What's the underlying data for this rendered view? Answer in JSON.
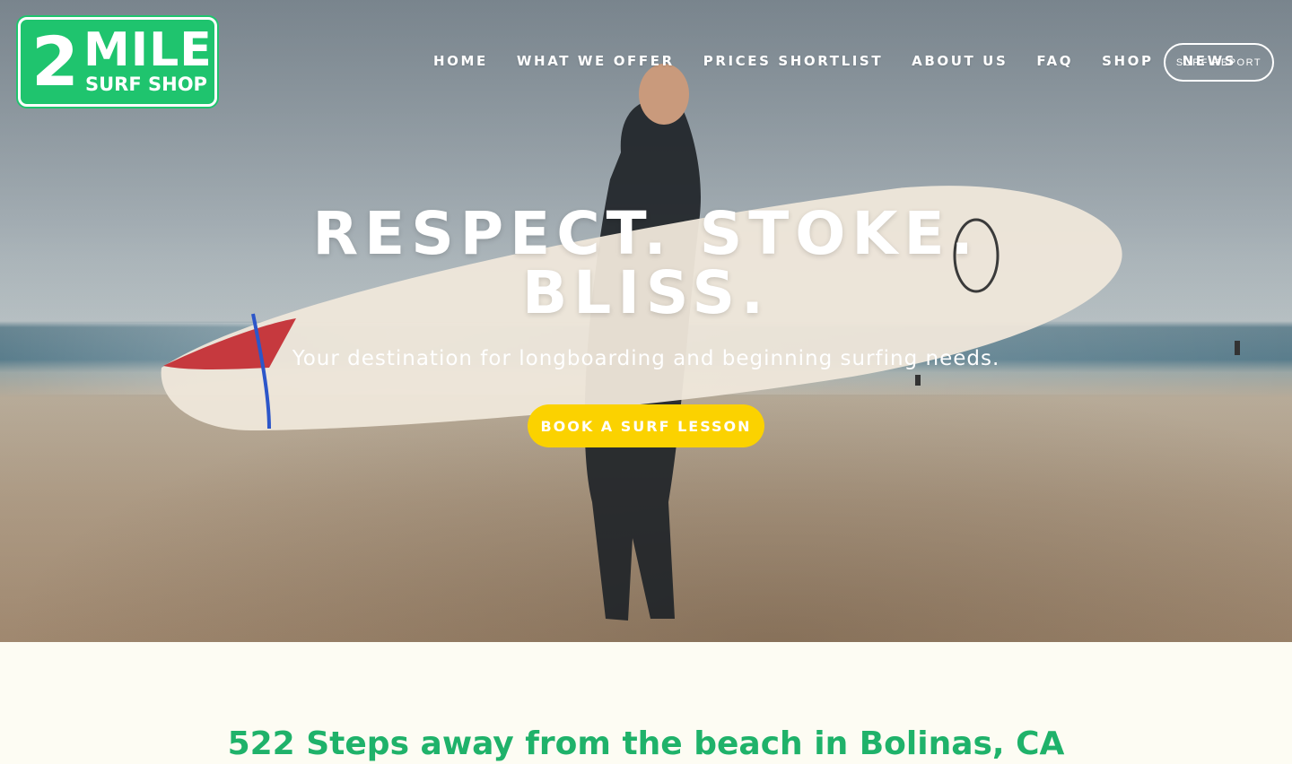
{
  "logo": {
    "number": "2",
    "word1": "MILE",
    "word2": "SURF SHOP"
  },
  "nav": {
    "items": [
      "HOME",
      "WHAT WE OFFER",
      "PRICES SHORTLIST",
      "ABOUT US",
      "FAQ",
      "SHOP",
      "NEWS"
    ],
    "report_button": "SURF REPORT"
  },
  "hero": {
    "headline": "RESPECT. STOKE. BLISS.",
    "subline": "Your destination for longboarding and beginning surfing needs.",
    "cta": "BOOK A SURF LESSON"
  },
  "section": {
    "title": "522 Steps away from the beach in Bolinas, CA"
  },
  "colors": {
    "brand_green": "#1fc46e",
    "cta_yellow": "#fbd200",
    "page_bg": "#fdfcf3"
  }
}
